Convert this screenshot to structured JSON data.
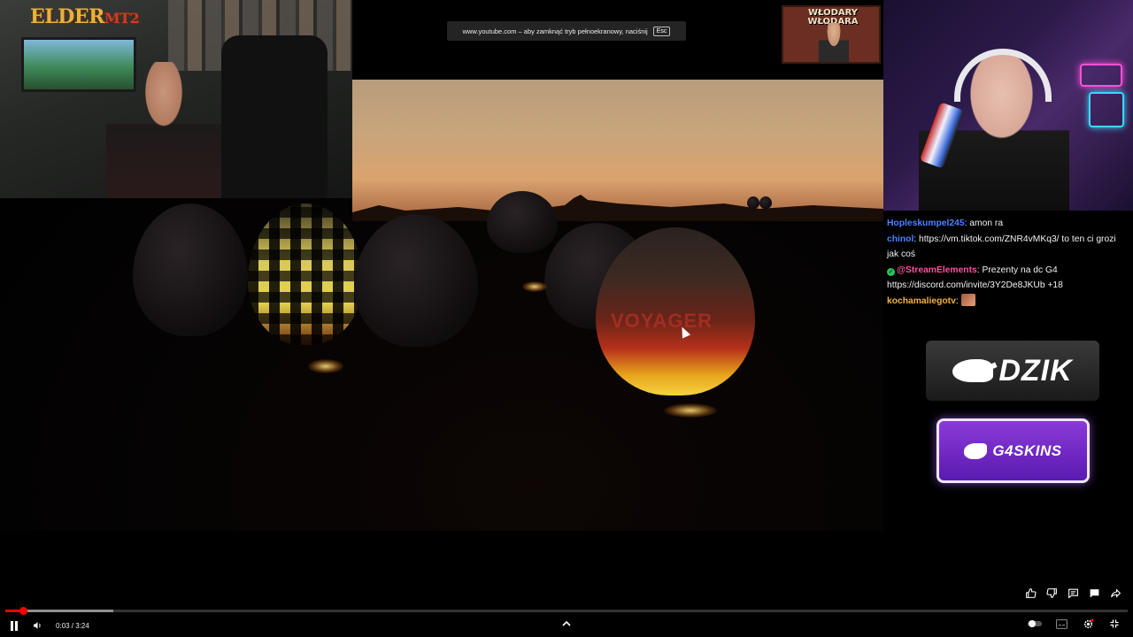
{
  "fullscreen_notice": {
    "text": "www.youtube.com – aby zamknąć tryb pełnoekranowy, naciśnij",
    "key": "Esc"
  },
  "overlay": {
    "left_logo": "ELDER",
    "left_logo_suffix": "MT2",
    "poster_line1": "WŁODARY",
    "poster_line2": "WŁODARA",
    "video_brand": "VOYAGER"
  },
  "chat": {
    "messages": [
      {
        "user": "Hopleskumpel245",
        "text": ": amon ra",
        "color": "blue"
      },
      {
        "user": "chinol",
        "text": ": https://vm.tiktok.com/ZNR4vMKq3/ to ten ci grozi jak coś",
        "color": "blue"
      },
      {
        "user": "@StreamElements",
        "text": ": Prezenty na dc G4 https://discord.com/invite/3Y2De8JKUb +18",
        "color": "pink",
        "verified": true
      },
      {
        "user": "kochamaliegotv",
        "text": ":",
        "color": "gold",
        "emote": true
      }
    ]
  },
  "sponsors": {
    "dzik": "DZIK",
    "g4skins": "G4SKINS"
  },
  "player": {
    "time": "0:03 / 3:24",
    "progress_played": 0.0156,
    "progress_loaded": 0.096,
    "icons": {
      "like": "thumb-up-icon",
      "dislike": "thumb-down-icon",
      "comments": "comment-icon",
      "chat": "chat-icon",
      "share": "share-icon",
      "pause": "pause-icon",
      "volume": "volume-icon",
      "up": "chevron-up-icon",
      "autoplay": "autoplay-toggle-icon",
      "subtitles": "subtitles-icon",
      "settings": "gear-icon",
      "exit_fullscreen": "exit-fullscreen-icon"
    }
  }
}
